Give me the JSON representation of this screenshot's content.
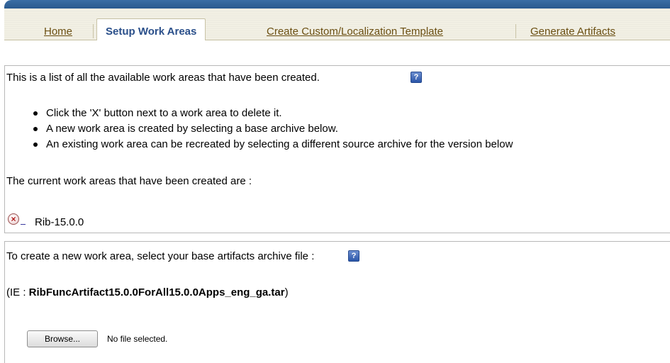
{
  "tabs": [
    {
      "label": "Home"
    },
    {
      "label": "Setup Work Areas"
    },
    {
      "label": "Create Custom/Localization Template"
    },
    {
      "label": "Generate Artifacts"
    }
  ],
  "work_areas_panel": {
    "intro": "This is a list of all the available work areas that have been created.",
    "bullets": [
      "Click the 'X' button next to a work area to delete it.",
      "A new work area is created by selecting a base archive below.",
      "An existing work area can be recreated by selecting a different source archive for the version below"
    ],
    "current_label": "The current work areas that have been created are :",
    "work_area_name": "Rib-15.0.0"
  },
  "create_panel": {
    "instruction": "To create a new work area, select your base artifacts archive file :",
    "example_prefix": "(IE : ",
    "example_file": "RibFuncArtifact15.0.0ForAll15.0.0Apps_eng_ga.tar",
    "example_suffix": ")",
    "browse_label": "Browse...",
    "no_file_text": "No file selected."
  },
  "icons": {
    "help": "help-icon",
    "delete": "delete-x-icon"
  }
}
